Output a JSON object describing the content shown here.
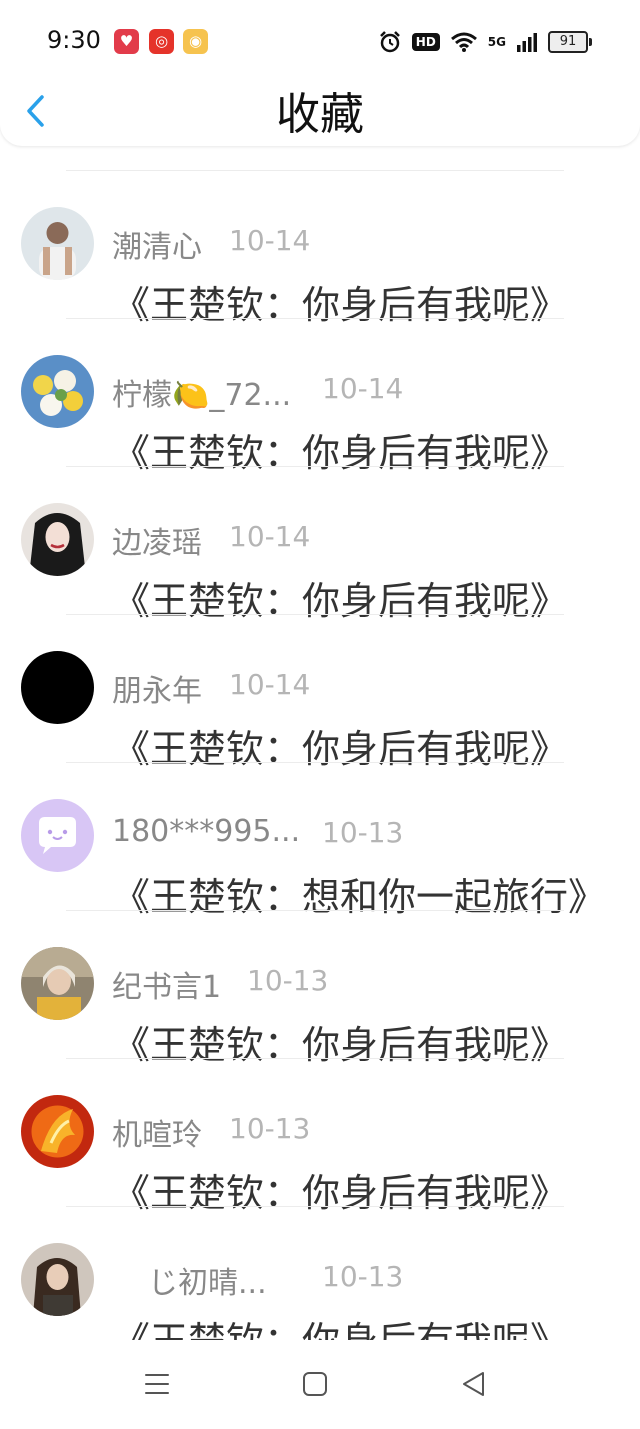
{
  "status_bar": {
    "time": "9:30",
    "apps": [
      {
        "icon": "hearts-app-icon",
        "color": "#e23b4a"
      },
      {
        "icon": "netease-music-icon",
        "color": "#e5332a"
      },
      {
        "icon": "weibo-icon",
        "color": "#f6c34f"
      }
    ],
    "hd": "HD",
    "network": "5G",
    "battery": "91"
  },
  "header": {
    "title": "收藏",
    "accent_color": "#2aa1ea"
  },
  "items": [
    {
      "name": "潮清心",
      "date": "10-14",
      "message": "《王楚钦：你身后有我呢》",
      "avatar_color": "#c9d2d8"
    },
    {
      "name": "柠檬🍋_72...",
      "date": "10-14",
      "message": "《王楚钦：你身后有我呢》",
      "avatar_color": "#d9c55a"
    },
    {
      "name": "边凌瑶",
      "date": "10-14",
      "message": "《王楚钦：你身后有我呢》",
      "avatar_color": "#2a2a2a"
    },
    {
      "name": "朋永年",
      "date": "10-14",
      "message": "《王楚钦：你身后有我呢》",
      "avatar_color": "#000000"
    },
    {
      "name": "180***995...",
      "date": "10-13",
      "message": "《王楚钦：想和你一起旅行》",
      "avatar_color": "#d8c6f5"
    },
    {
      "name": "纪书言1",
      "date": "10-13",
      "message": "《王楚钦：你身后有我呢》",
      "avatar_color": "#9a8a70"
    },
    {
      "name": "机暄玲",
      "date": "10-13",
      "message": "《王楚钦：你身后有我呢》",
      "avatar_color": "#e2561a"
    },
    {
      "name": "じ初晴...",
      "date": "10-13",
      "message": "《王楚钦：你身后有我呢》",
      "avatar_color": "#6b5a4a"
    }
  ]
}
